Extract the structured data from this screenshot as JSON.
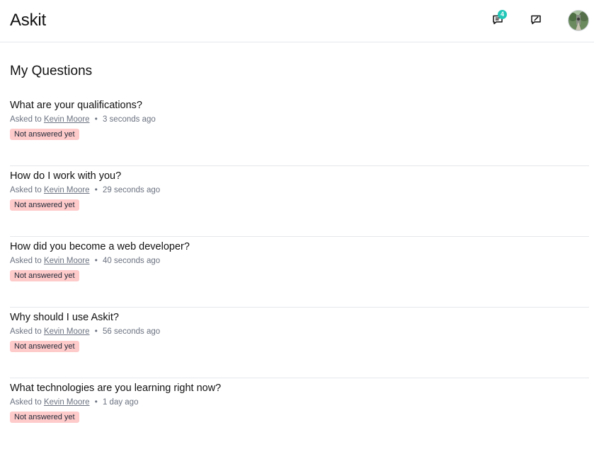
{
  "header": {
    "app_title": "Askit",
    "notifications_count": "4",
    "icons": {
      "notifications": "chat-bubble-text-icon",
      "ask": "chat-bubble-edit-icon",
      "avatar": "user-avatar"
    },
    "badge_color": "#22c7b8"
  },
  "page": {
    "title": "My Questions"
  },
  "labels": {
    "asked_to": "Asked to",
    "separator": "•"
  },
  "status_color": "#fecaca",
  "questions": [
    {
      "title": "What are your qualifications?",
      "author": "Kevin Moore",
      "time": "3 seconds ago",
      "status": "Not answered yet"
    },
    {
      "title": "How do I work with you?",
      "author": "Kevin Moore",
      "time": "29 seconds ago",
      "status": "Not answered yet"
    },
    {
      "title": "How did you become a web developer?",
      "author": "Kevin Moore",
      "time": "40 seconds ago",
      "status": "Not answered yet"
    },
    {
      "title": "Why should I use Askit?",
      "author": "Kevin Moore",
      "time": "56 seconds ago",
      "status": "Not answered yet"
    },
    {
      "title": "What technologies are you learning right now?",
      "author": "Kevin Moore",
      "time": "1 day ago",
      "status": "Not answered yet"
    }
  ]
}
